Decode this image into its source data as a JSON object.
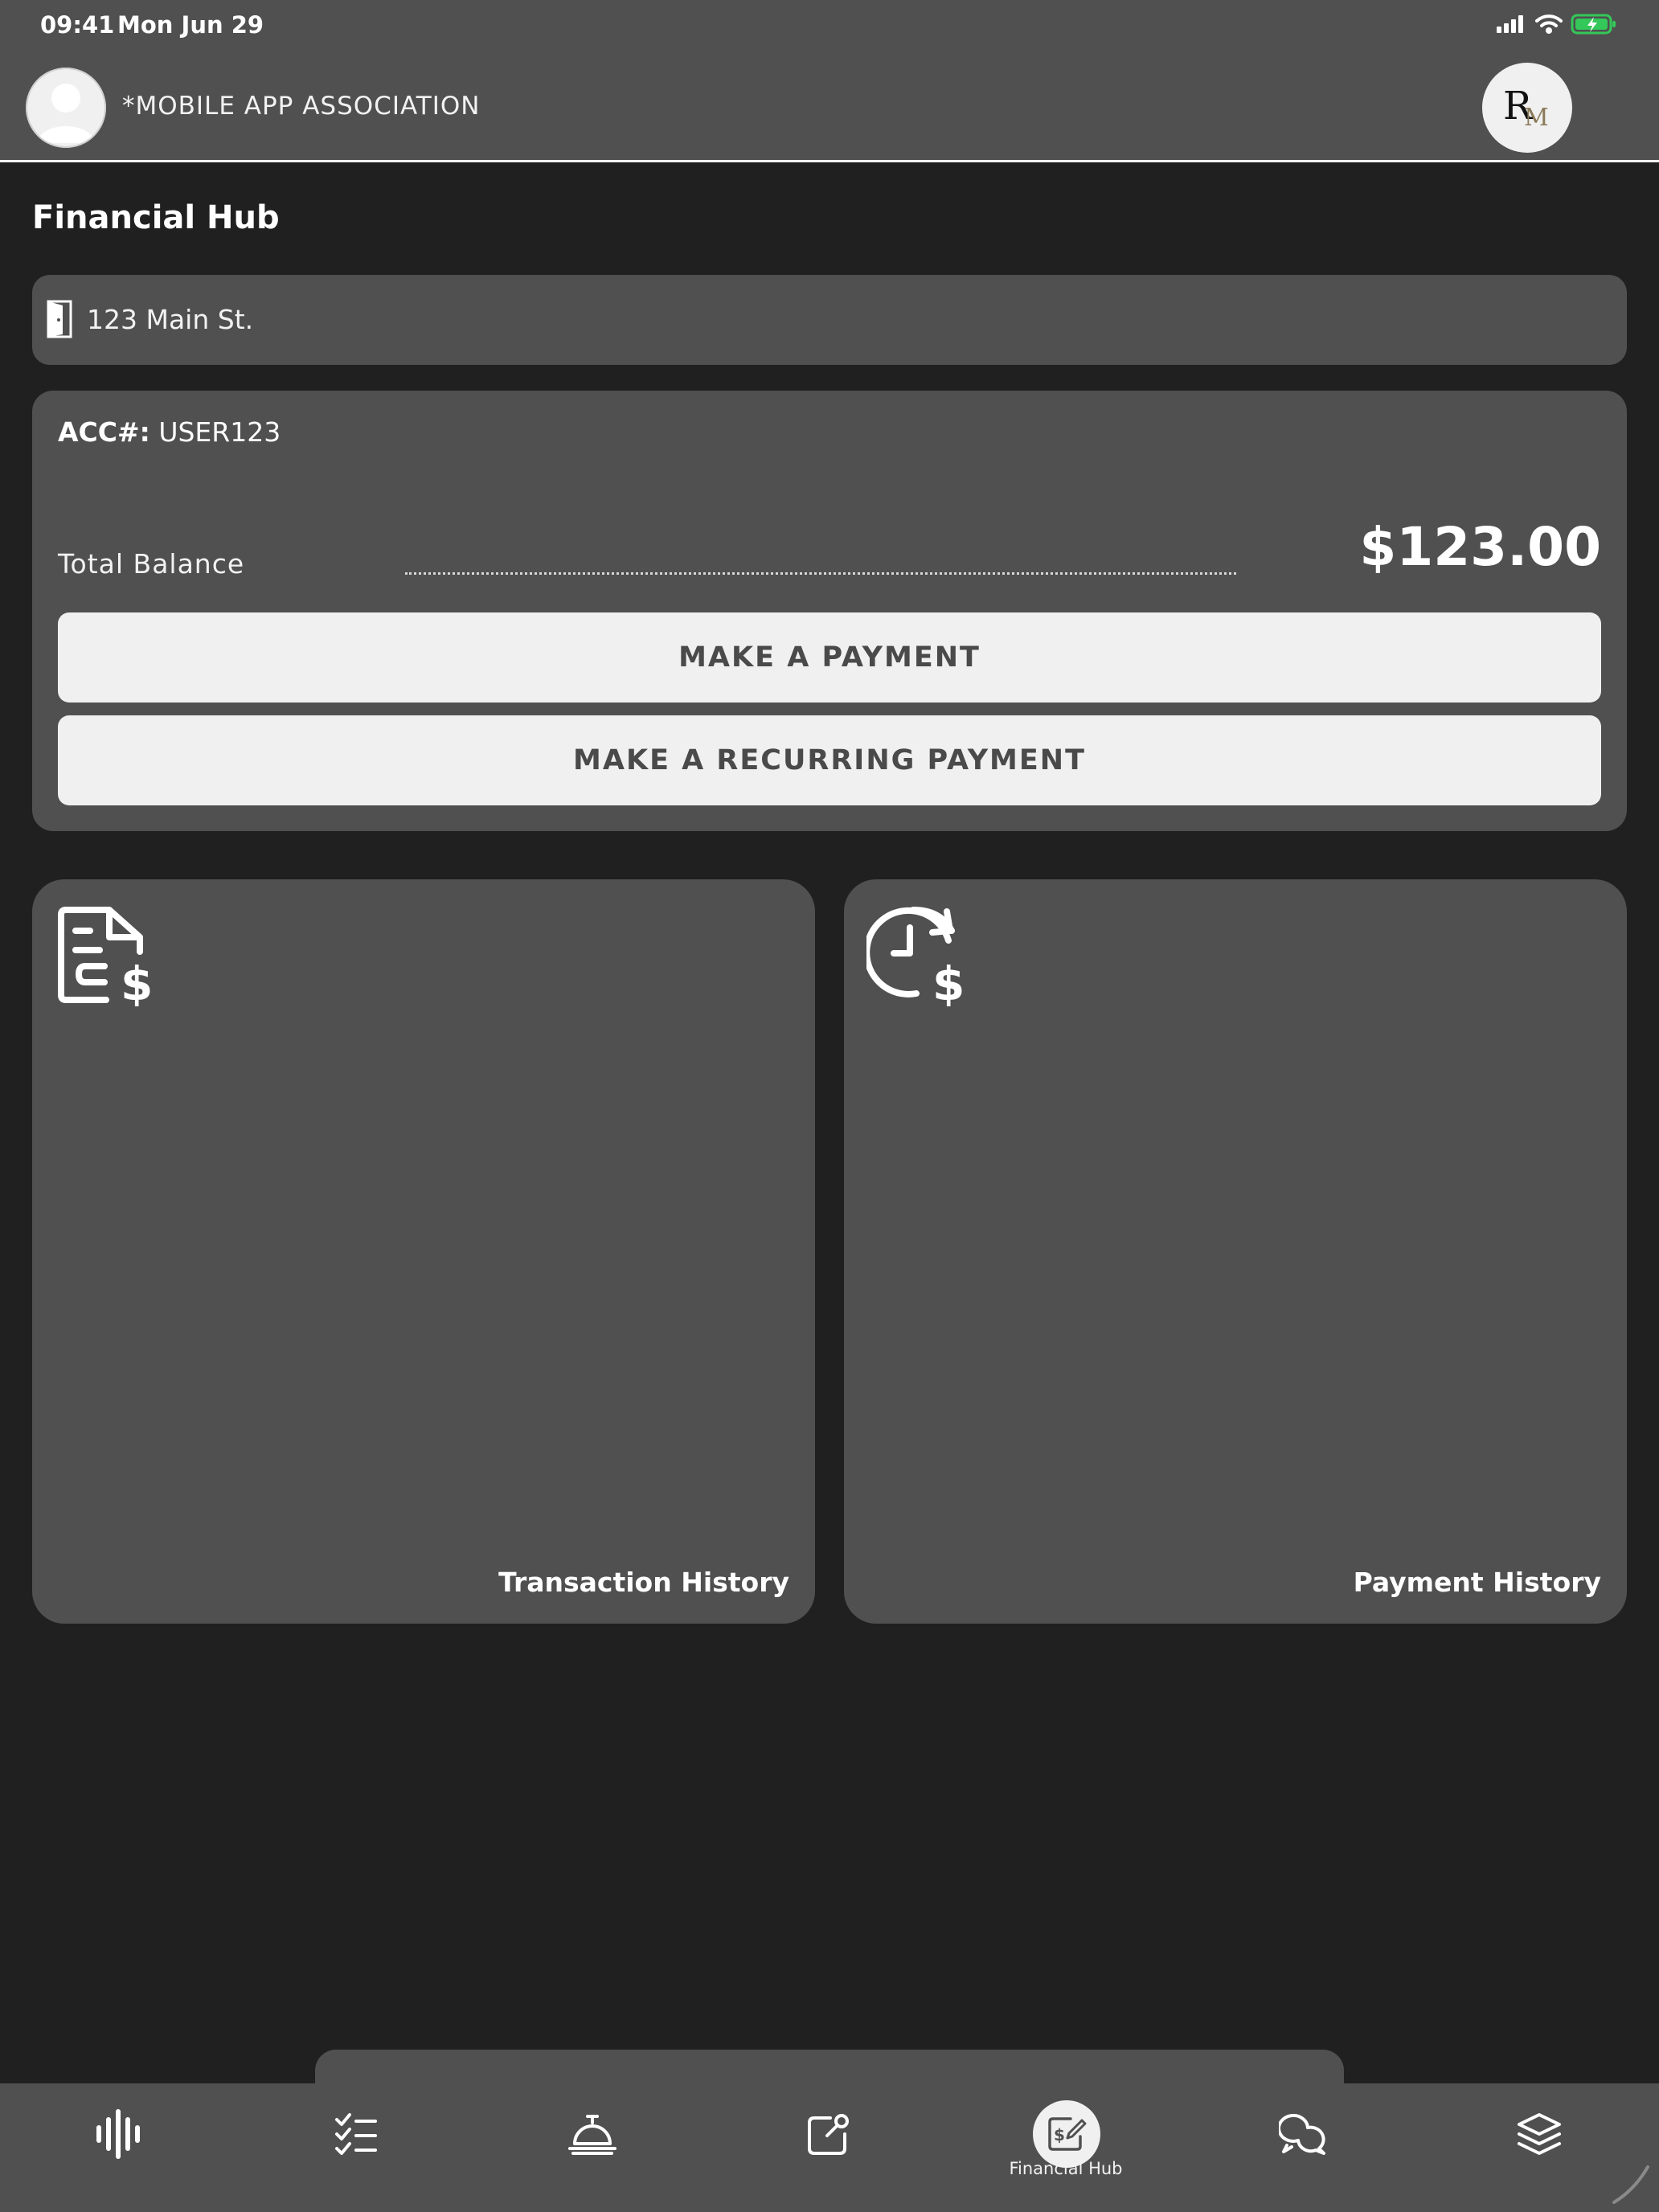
{
  "status_bar": {
    "time": "09:41",
    "date": "Mon Jun 29",
    "icons": [
      "cellular-signal-icon",
      "wifi-icon",
      "battery-charging-icon"
    ],
    "battery_color": "#34c759"
  },
  "header": {
    "organization": "*MOBILE APP ASSOCIATION",
    "avatar_icon": "user-avatar-icon",
    "logo_text": "RM"
  },
  "page": {
    "title": "Financial Hub"
  },
  "address": {
    "icon": "door-icon",
    "text": "123 Main St."
  },
  "account": {
    "acc_label": "ACC#:",
    "acc_value": "USER123",
    "balance_label": "Total Balance",
    "balance_amount": "$123.00",
    "make_payment_label": "MAKE A PAYMENT",
    "recurring_payment_label": "MAKE A RECURRING PAYMENT"
  },
  "tiles": [
    {
      "label": "Transaction History",
      "icon": "invoice-dollar-icon"
    },
    {
      "label": "Payment History",
      "icon": "clock-dollar-icon"
    }
  ],
  "bottom_nav": {
    "items": [
      {
        "icon": "audio-wave-icon",
        "label": ""
      },
      {
        "icon": "checklist-icon",
        "label": ""
      },
      {
        "icon": "service-bell-icon",
        "label": ""
      },
      {
        "icon": "edit-square-icon",
        "label": ""
      },
      {
        "icon": "dollar-document-edit-icon",
        "label": "Financial Hub",
        "active": true
      },
      {
        "icon": "chat-bubbles-icon",
        "label": ""
      },
      {
        "icon": "layers-icon",
        "label": ""
      }
    ],
    "active_label": "Financial Hub"
  },
  "colors": {
    "background": "#202020",
    "panel": "#505050",
    "button": "#f0f0f0",
    "button_text": "#4a4a4a"
  }
}
